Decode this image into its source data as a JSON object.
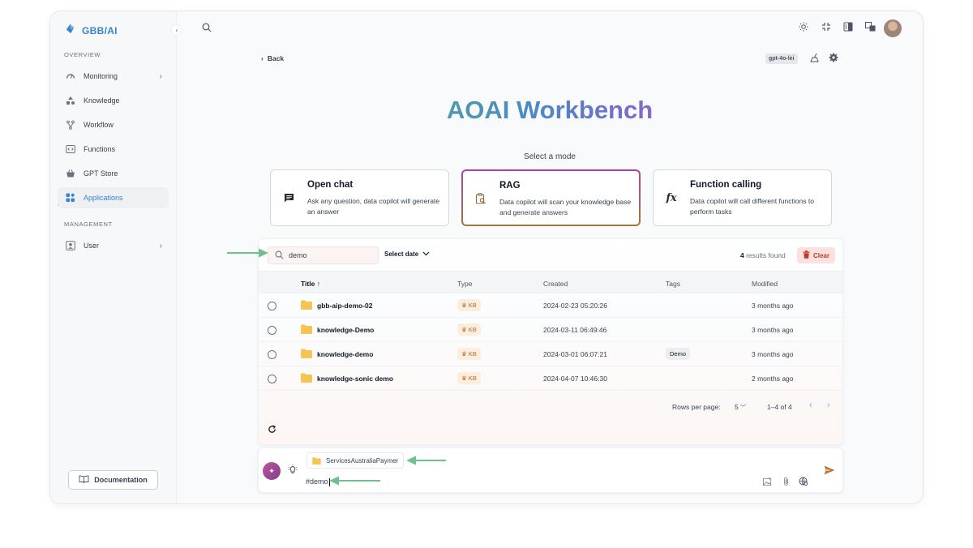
{
  "app": {
    "brand": "GBB/AI"
  },
  "sidebar": {
    "overview_label": "OVERVIEW",
    "management_label": "MANAGEMENT",
    "items": [
      {
        "label": "Monitoring",
        "icon": "gauge-icon"
      },
      {
        "label": "Knowledge",
        "icon": "shapes-icon"
      },
      {
        "label": "Workflow",
        "icon": "branch-icon"
      },
      {
        "label": "Functions",
        "icon": "code-icon"
      },
      {
        "label": "GPT Store",
        "icon": "basket-icon"
      },
      {
        "label": "Applications",
        "icon": "apps-icon"
      }
    ],
    "management_items": [
      {
        "label": "User",
        "icon": "user-card-icon"
      }
    ],
    "documentation_label": "Documentation"
  },
  "header": {
    "back_label": "Back",
    "model": "gpt-4o-lei",
    "title": "AOAI Workbench",
    "mode_prompt": "Select a mode"
  },
  "modes": [
    {
      "title": "Open chat",
      "desc": "Ask any question, data copilot will generate an answer"
    },
    {
      "title": "RAG",
      "desc": "Data copilot will scan your knowledge base and generate answers"
    },
    {
      "title": "Function calling",
      "desc": "Data copilot will call different functions to perform tasks"
    }
  ],
  "toolbar": {
    "search_value": "demo",
    "date_label": "Select date",
    "results_count": "4",
    "results_suffix": " results found",
    "clear_label": "Clear"
  },
  "table": {
    "columns": [
      "Title",
      "Type",
      "Created",
      "Tags",
      "Modified"
    ],
    "rows": [
      {
        "title": "gbb-aip-demo-02",
        "type": "KB",
        "created": "2024-02-23 05:20:26",
        "tag": "",
        "modified": "3 months ago"
      },
      {
        "title": "knowledge-Demo",
        "type": "KB",
        "created": "2024-03-11 06:49:46",
        "tag": "",
        "modified": "3 months ago"
      },
      {
        "title": "knowledge-demo",
        "type": "KB",
        "created": "2024-03-01 06:07:21",
        "tag": "Demo",
        "modified": "3 months ago"
      },
      {
        "title": "knowledge-sonic demo",
        "type": "KB",
        "created": "2024-04-07 10:46:30",
        "tag": "",
        "modified": "2 months ago"
      }
    ]
  },
  "pagination": {
    "rows_per_page_label": "Rows per page:",
    "rows_per_page": "5",
    "range": "1–4 of 4"
  },
  "chat": {
    "attachment": "ServicesAustraliaPaymer",
    "input_value": "#demo"
  },
  "colors": {
    "accent": "#3a83c9",
    "clear_red": "#c0392b",
    "annotation_arrow": "#6fbf8f",
    "folder": "#f5c453"
  }
}
